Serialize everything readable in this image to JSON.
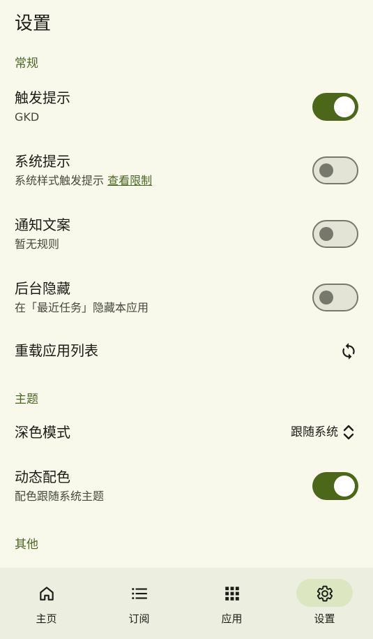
{
  "page": {
    "title": "设置"
  },
  "sections": {
    "general": "常规",
    "theme": "主题",
    "other": "其他"
  },
  "settings": {
    "trigger_hint": {
      "title": "触发提示",
      "subtitle": "GKD",
      "enabled": true
    },
    "system_hint": {
      "title": "系统提示",
      "subtitle": "系统样式触发提示",
      "link": "查看限制",
      "enabled": false
    },
    "notification_text": {
      "title": "通知文案",
      "subtitle": "暂无规则",
      "enabled": false
    },
    "background_hide": {
      "title": "后台隐藏",
      "subtitle": "在「最近任务」隐藏本应用",
      "enabled": false
    },
    "reload_apps": {
      "title": "重载应用列表",
      "icon": "refresh-icon"
    },
    "dark_mode": {
      "title": "深色模式",
      "value": "跟随系统",
      "icon": "unfold-icon"
    },
    "dynamic_color": {
      "title": "动态配色",
      "subtitle": "配色跟随系统主题",
      "enabled": true
    }
  },
  "nav": {
    "items": [
      {
        "label": "主页",
        "icon": "home-icon",
        "active": false
      },
      {
        "label": "订阅",
        "icon": "list-icon",
        "active": false
      },
      {
        "label": "应用",
        "icon": "apps-grid-icon",
        "active": false
      },
      {
        "label": "设置",
        "icon": "settings-icon",
        "active": true
      }
    ]
  },
  "colors": {
    "accent": "#4c661a",
    "background": "#f8f9ea",
    "nav_background": "#eceedf",
    "active_pill": "#dce7c1"
  }
}
